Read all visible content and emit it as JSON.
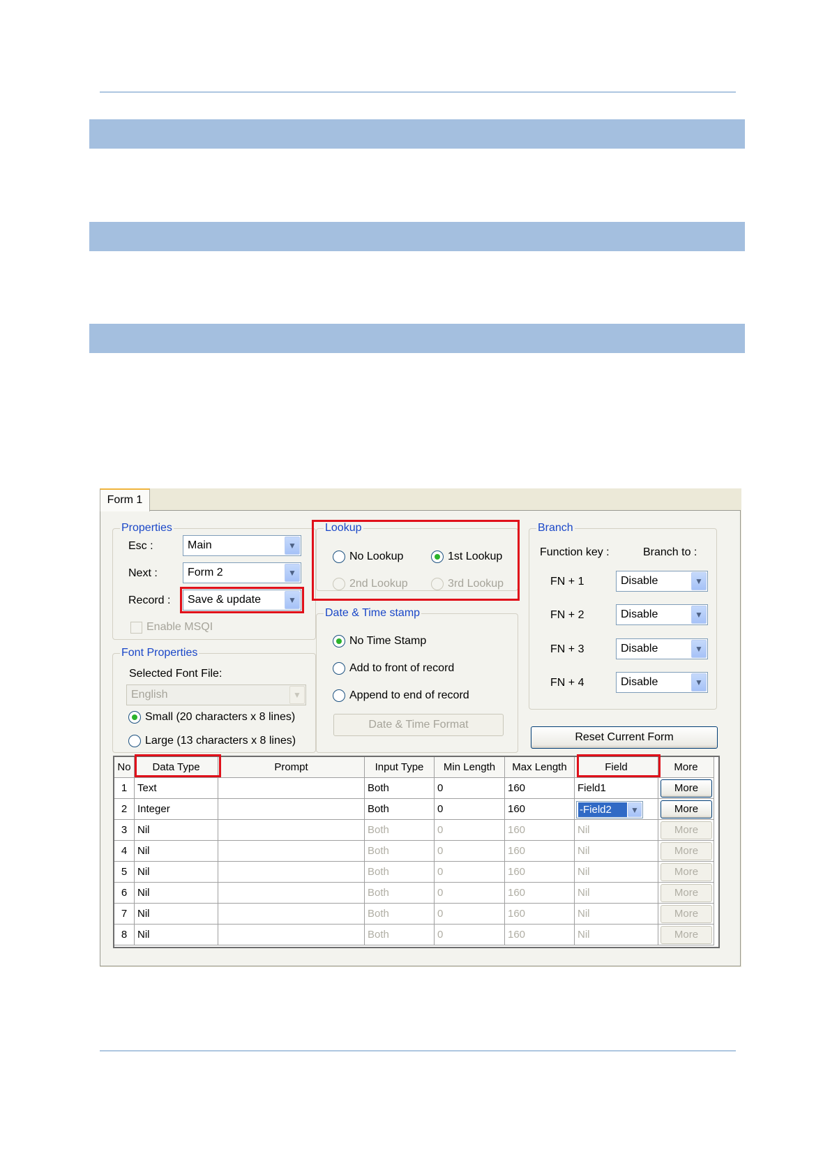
{
  "form": {
    "tab_label": "Form 1",
    "properties": {
      "title": "Properties",
      "esc_label": "Esc :",
      "esc_value": "Main",
      "next_label": "Next :",
      "next_value": "Form 2",
      "record_label": "Record :",
      "record_value": "Save & update",
      "enable_msqi": "Enable MSQI"
    },
    "font_properties": {
      "title": "Font Properties",
      "selected_font_label": "Selected Font File:",
      "font_value": "English",
      "small_option": "Small (20 characters x 8 lines)",
      "large_option": "Large (13 characters x 8 lines)"
    },
    "lookup": {
      "title": "Lookup",
      "no_lookup": "No Lookup",
      "first_lookup": "1st Lookup",
      "second_lookup": "2nd Lookup",
      "third_lookup": "3rd Lookup"
    },
    "date_time": {
      "title": "Date & Time stamp",
      "no_time_stamp": "No Time Stamp",
      "add_front": "Add to front of record",
      "append_end": "Append to end of record",
      "format_button": "Date & Time Format"
    },
    "branch": {
      "title": "Branch",
      "function_key_label": "Function key :",
      "branch_to_label": "Branch to :",
      "keys": [
        {
          "key": "FN + 1",
          "value": "Disable"
        },
        {
          "key": "FN + 2",
          "value": "Disable"
        },
        {
          "key": "FN + 3",
          "value": "Disable"
        },
        {
          "key": "FN + 4",
          "value": "Disable"
        }
      ],
      "reset_button": "Reset Current Form"
    },
    "grid": {
      "headers": [
        "No",
        "Data Type",
        "Prompt",
        "Input Type",
        "Min Length",
        "Max Length",
        "Field",
        "More"
      ],
      "rows": [
        {
          "no": "1",
          "data_type": "Text",
          "prompt": "",
          "input_type": "Both",
          "min": "0",
          "max": "160",
          "field": "Field1",
          "more": "More"
        },
        {
          "no": "2",
          "data_type": "Integer",
          "prompt": "",
          "input_type": "Both",
          "min": "0",
          "max": "160",
          "field": "-Field2",
          "more": "More"
        },
        {
          "no": "3",
          "data_type": "Nil",
          "prompt": "",
          "input_type": "Both",
          "min": "0",
          "max": "160",
          "field": "Nil",
          "more": "More"
        },
        {
          "no": "4",
          "data_type": "Nil",
          "prompt": "",
          "input_type": "Both",
          "min": "0",
          "max": "160",
          "field": "Nil",
          "more": "More"
        },
        {
          "no": "5",
          "data_type": "Nil",
          "prompt": "",
          "input_type": "Both",
          "min": "0",
          "max": "160",
          "field": "Nil",
          "more": "More"
        },
        {
          "no": "6",
          "data_type": "Nil",
          "prompt": "",
          "input_type": "Both",
          "min": "0",
          "max": "160",
          "field": "Nil",
          "more": "More"
        },
        {
          "no": "7",
          "data_type": "Nil",
          "prompt": "",
          "input_type": "Both",
          "min": "0",
          "max": "160",
          "field": "Nil",
          "more": "More"
        },
        {
          "no": "8",
          "data_type": "Nil",
          "prompt": "",
          "input_type": "Both",
          "min": "0",
          "max": "160",
          "field": "Nil",
          "more": "More"
        }
      ]
    }
  },
  "colors": {
    "section_band": "#a4bfdf",
    "group_title": "#1a47c8",
    "highlight_box": "#e0101a",
    "selection": "#316ac5"
  }
}
